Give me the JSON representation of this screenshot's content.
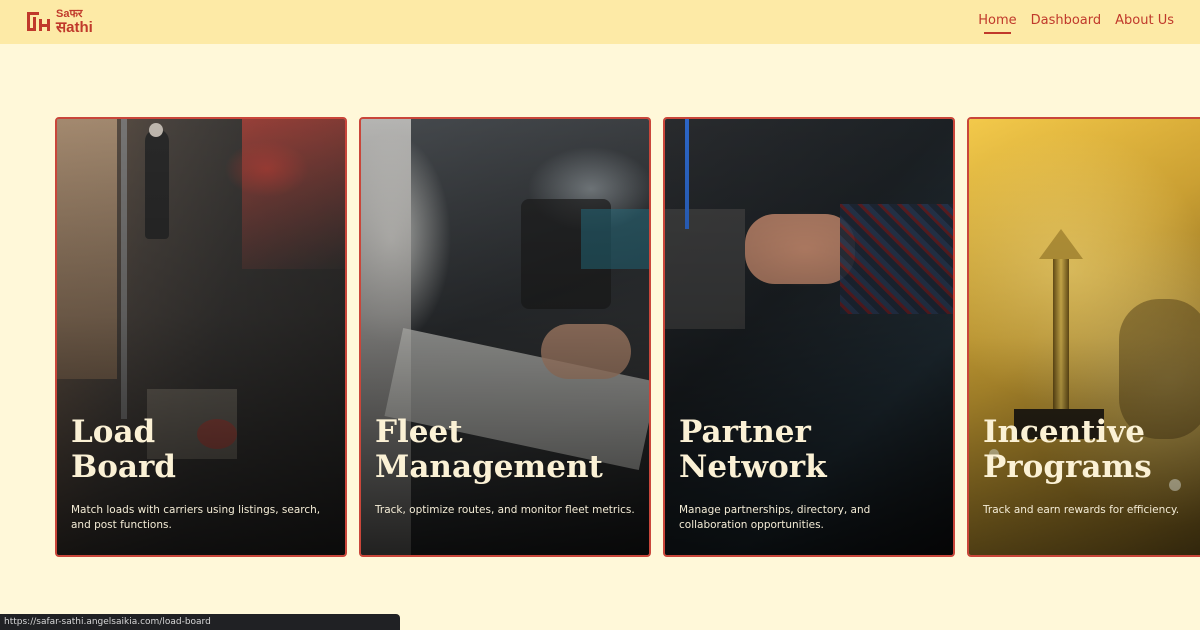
{
  "brand": {
    "line1": "Saफर",
    "line2": "सathi",
    "accent": "#c0392b"
  },
  "nav": {
    "items": [
      {
        "label": "Home",
        "active": true
      },
      {
        "label": "Dashboard",
        "active": false
      },
      {
        "label": "About Us",
        "active": false
      }
    ]
  },
  "cards": [
    {
      "title": "Load\nBoard",
      "description": "Match loads with carriers using listings, search, and post functions."
    },
    {
      "title": "Fleet\nManagement",
      "description": "Track, optimize routes, and monitor fleet metrics."
    },
    {
      "title": "Partner\nNetwork",
      "description": "Manage partnerships, directory, and collaboration opportunities."
    },
    {
      "title": "Incentive\nPrograms",
      "description": "Track and earn rewards for efficiency."
    }
  ],
  "status_url": "https://safar-sathi.angelsaikia.com/load-board"
}
